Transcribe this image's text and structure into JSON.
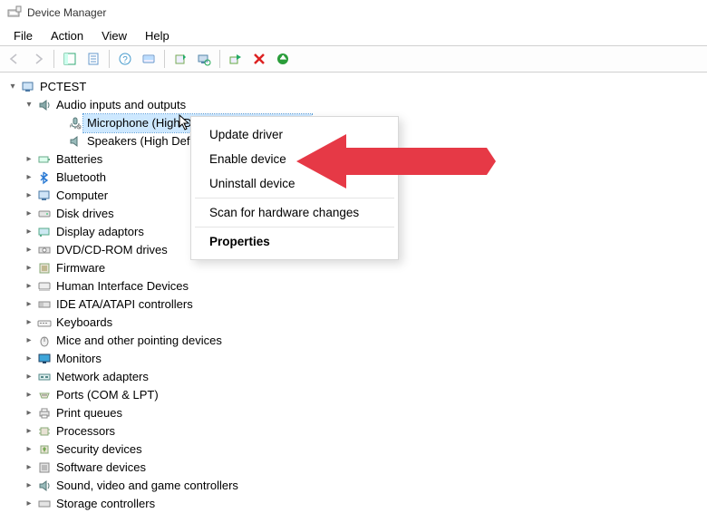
{
  "window": {
    "title": "Device Manager"
  },
  "menu": {
    "file": "File",
    "action": "Action",
    "view": "View",
    "help": "Help"
  },
  "toolbar_icons": {
    "back": "back-arrow-icon",
    "forward": "forward-arrow-icon",
    "show_hidden": "show-hide-console-tree-icon",
    "properties": "properties-icon",
    "help": "help-icon",
    "printers": "devices-icon",
    "computer": "scan-hardware-icon",
    "add_device": "add-legacy-icon",
    "disable": "disable-device-icon",
    "uninstall": "uninstall-icon",
    "update": "update-driver-icon"
  },
  "tree": {
    "root": "PCTEST",
    "audio": {
      "label": "Audio inputs and outputs",
      "mic": "Microphone (High Definition Audio Device)",
      "speakers": "Speakers (High Defin"
    },
    "batteries": "Batteries",
    "bluetooth": "Bluetooth",
    "computer": "Computer",
    "disk_drives": "Disk drives",
    "display_adaptors": "Display adaptors",
    "dvd": "DVD/CD-ROM drives",
    "firmware": "Firmware",
    "hid": "Human Interface Devices",
    "ide": "IDE ATA/ATAPI controllers",
    "keyboards": "Keyboards",
    "mice": "Mice and other pointing devices",
    "monitors": "Monitors",
    "network": "Network adapters",
    "ports": "Ports (COM & LPT)",
    "print_queues": "Print queues",
    "processors": "Processors",
    "security": "Security devices",
    "software": "Software devices",
    "sound": "Sound, video and game controllers",
    "storage": "Storage controllers"
  },
  "context_menu": {
    "update": "Update driver",
    "enable": "Enable device",
    "uninstall": "Uninstall device",
    "scan": "Scan for hardware changes",
    "properties": "Properties"
  },
  "colors": {
    "arrow": "#e63946",
    "selection": "#cde8ff"
  }
}
